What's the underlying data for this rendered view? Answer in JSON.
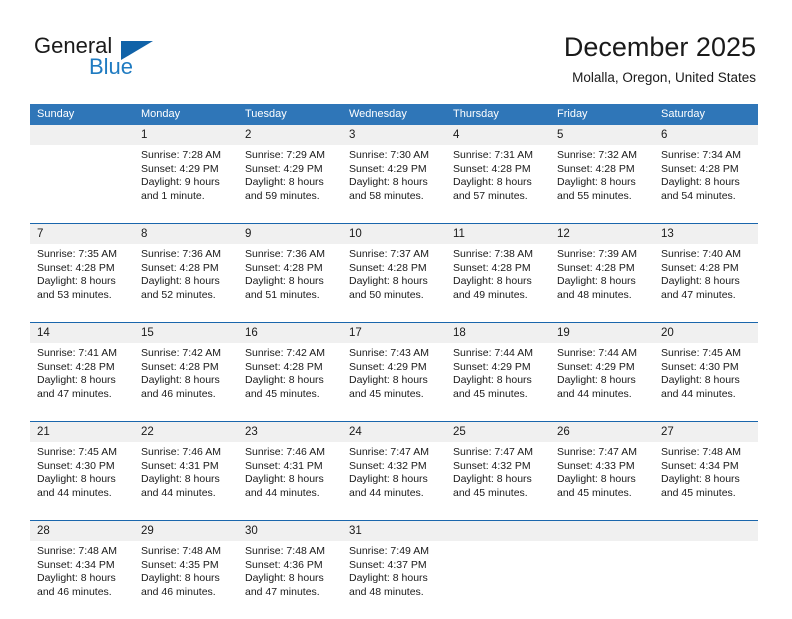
{
  "brand": {
    "name_part1": "General",
    "name_part2": "Blue",
    "flag_color": "#1062a8",
    "blue_text_color": "#1f7bc1"
  },
  "header": {
    "title": "December 2025",
    "subtitle": "Molalla, Oregon, United States",
    "header_bg_color": "#2f76b8",
    "header_text_color": "#ffffff",
    "week_separator_color": "#1a66ac",
    "day_number_band_color": "#f0f0f0"
  },
  "weekdays": [
    "Sunday",
    "Monday",
    "Tuesday",
    "Wednesday",
    "Thursday",
    "Friday",
    "Saturday"
  ],
  "weeks": [
    {
      "days": [
        {
          "num": "",
          "lines": [
            "",
            "",
            "",
            ""
          ]
        },
        {
          "num": "1",
          "lines": [
            "Sunrise: 7:28 AM",
            "Sunset: 4:29 PM",
            "Daylight: 9 hours",
            "and 1 minute."
          ]
        },
        {
          "num": "2",
          "lines": [
            "Sunrise: 7:29 AM",
            "Sunset: 4:29 PM",
            "Daylight: 8 hours",
            "and 59 minutes."
          ]
        },
        {
          "num": "3",
          "lines": [
            "Sunrise: 7:30 AM",
            "Sunset: 4:29 PM",
            "Daylight: 8 hours",
            "and 58 minutes."
          ]
        },
        {
          "num": "4",
          "lines": [
            "Sunrise: 7:31 AM",
            "Sunset: 4:28 PM",
            "Daylight: 8 hours",
            "and 57 minutes."
          ]
        },
        {
          "num": "5",
          "lines": [
            "Sunrise: 7:32 AM",
            "Sunset: 4:28 PM",
            "Daylight: 8 hours",
            "and 55 minutes."
          ]
        },
        {
          "num": "6",
          "lines": [
            "Sunrise: 7:34 AM",
            "Sunset: 4:28 PM",
            "Daylight: 8 hours",
            "and 54 minutes."
          ]
        }
      ]
    },
    {
      "days": [
        {
          "num": "7",
          "lines": [
            "Sunrise: 7:35 AM",
            "Sunset: 4:28 PM",
            "Daylight: 8 hours",
            "and 53 minutes."
          ]
        },
        {
          "num": "8",
          "lines": [
            "Sunrise: 7:36 AM",
            "Sunset: 4:28 PM",
            "Daylight: 8 hours",
            "and 52 minutes."
          ]
        },
        {
          "num": "9",
          "lines": [
            "Sunrise: 7:36 AM",
            "Sunset: 4:28 PM",
            "Daylight: 8 hours",
            "and 51 minutes."
          ]
        },
        {
          "num": "10",
          "lines": [
            "Sunrise: 7:37 AM",
            "Sunset: 4:28 PM",
            "Daylight: 8 hours",
            "and 50 minutes."
          ]
        },
        {
          "num": "11",
          "lines": [
            "Sunrise: 7:38 AM",
            "Sunset: 4:28 PM",
            "Daylight: 8 hours",
            "and 49 minutes."
          ]
        },
        {
          "num": "12",
          "lines": [
            "Sunrise: 7:39 AM",
            "Sunset: 4:28 PM",
            "Daylight: 8 hours",
            "and 48 minutes."
          ]
        },
        {
          "num": "13",
          "lines": [
            "Sunrise: 7:40 AM",
            "Sunset: 4:28 PM",
            "Daylight: 8 hours",
            "and 47 minutes."
          ]
        }
      ]
    },
    {
      "days": [
        {
          "num": "14",
          "lines": [
            "Sunrise: 7:41 AM",
            "Sunset: 4:28 PM",
            "Daylight: 8 hours",
            "and 47 minutes."
          ]
        },
        {
          "num": "15",
          "lines": [
            "Sunrise: 7:42 AM",
            "Sunset: 4:28 PM",
            "Daylight: 8 hours",
            "and 46 minutes."
          ]
        },
        {
          "num": "16",
          "lines": [
            "Sunrise: 7:42 AM",
            "Sunset: 4:28 PM",
            "Daylight: 8 hours",
            "and 45 minutes."
          ]
        },
        {
          "num": "17",
          "lines": [
            "Sunrise: 7:43 AM",
            "Sunset: 4:29 PM",
            "Daylight: 8 hours",
            "and 45 minutes."
          ]
        },
        {
          "num": "18",
          "lines": [
            "Sunrise: 7:44 AM",
            "Sunset: 4:29 PM",
            "Daylight: 8 hours",
            "and 45 minutes."
          ]
        },
        {
          "num": "19",
          "lines": [
            "Sunrise: 7:44 AM",
            "Sunset: 4:29 PM",
            "Daylight: 8 hours",
            "and 44 minutes."
          ]
        },
        {
          "num": "20",
          "lines": [
            "Sunrise: 7:45 AM",
            "Sunset: 4:30 PM",
            "Daylight: 8 hours",
            "and 44 minutes."
          ]
        }
      ]
    },
    {
      "days": [
        {
          "num": "21",
          "lines": [
            "Sunrise: 7:45 AM",
            "Sunset: 4:30 PM",
            "Daylight: 8 hours",
            "and 44 minutes."
          ]
        },
        {
          "num": "22",
          "lines": [
            "Sunrise: 7:46 AM",
            "Sunset: 4:31 PM",
            "Daylight: 8 hours",
            "and 44 minutes."
          ]
        },
        {
          "num": "23",
          "lines": [
            "Sunrise: 7:46 AM",
            "Sunset: 4:31 PM",
            "Daylight: 8 hours",
            "and 44 minutes."
          ]
        },
        {
          "num": "24",
          "lines": [
            "Sunrise: 7:47 AM",
            "Sunset: 4:32 PM",
            "Daylight: 8 hours",
            "and 44 minutes."
          ]
        },
        {
          "num": "25",
          "lines": [
            "Sunrise: 7:47 AM",
            "Sunset: 4:32 PM",
            "Daylight: 8 hours",
            "and 45 minutes."
          ]
        },
        {
          "num": "26",
          "lines": [
            "Sunrise: 7:47 AM",
            "Sunset: 4:33 PM",
            "Daylight: 8 hours",
            "and 45 minutes."
          ]
        },
        {
          "num": "27",
          "lines": [
            "Sunrise: 7:48 AM",
            "Sunset: 4:34 PM",
            "Daylight: 8 hours",
            "and 45 minutes."
          ]
        }
      ]
    },
    {
      "days": [
        {
          "num": "28",
          "lines": [
            "Sunrise: 7:48 AM",
            "Sunset: 4:34 PM",
            "Daylight: 8 hours",
            "and 46 minutes."
          ]
        },
        {
          "num": "29",
          "lines": [
            "Sunrise: 7:48 AM",
            "Sunset: 4:35 PM",
            "Daylight: 8 hours",
            "and 46 minutes."
          ]
        },
        {
          "num": "30",
          "lines": [
            "Sunrise: 7:48 AM",
            "Sunset: 4:36 PM",
            "Daylight: 8 hours",
            "and 47 minutes."
          ]
        },
        {
          "num": "31",
          "lines": [
            "Sunrise: 7:49 AM",
            "Sunset: 4:37 PM",
            "Daylight: 8 hours",
            "and 48 minutes."
          ]
        },
        {
          "num": "",
          "lines": [
            "",
            "",
            "",
            ""
          ]
        },
        {
          "num": "",
          "lines": [
            "",
            "",
            "",
            ""
          ]
        },
        {
          "num": "",
          "lines": [
            "",
            "",
            "",
            ""
          ]
        }
      ]
    }
  ]
}
